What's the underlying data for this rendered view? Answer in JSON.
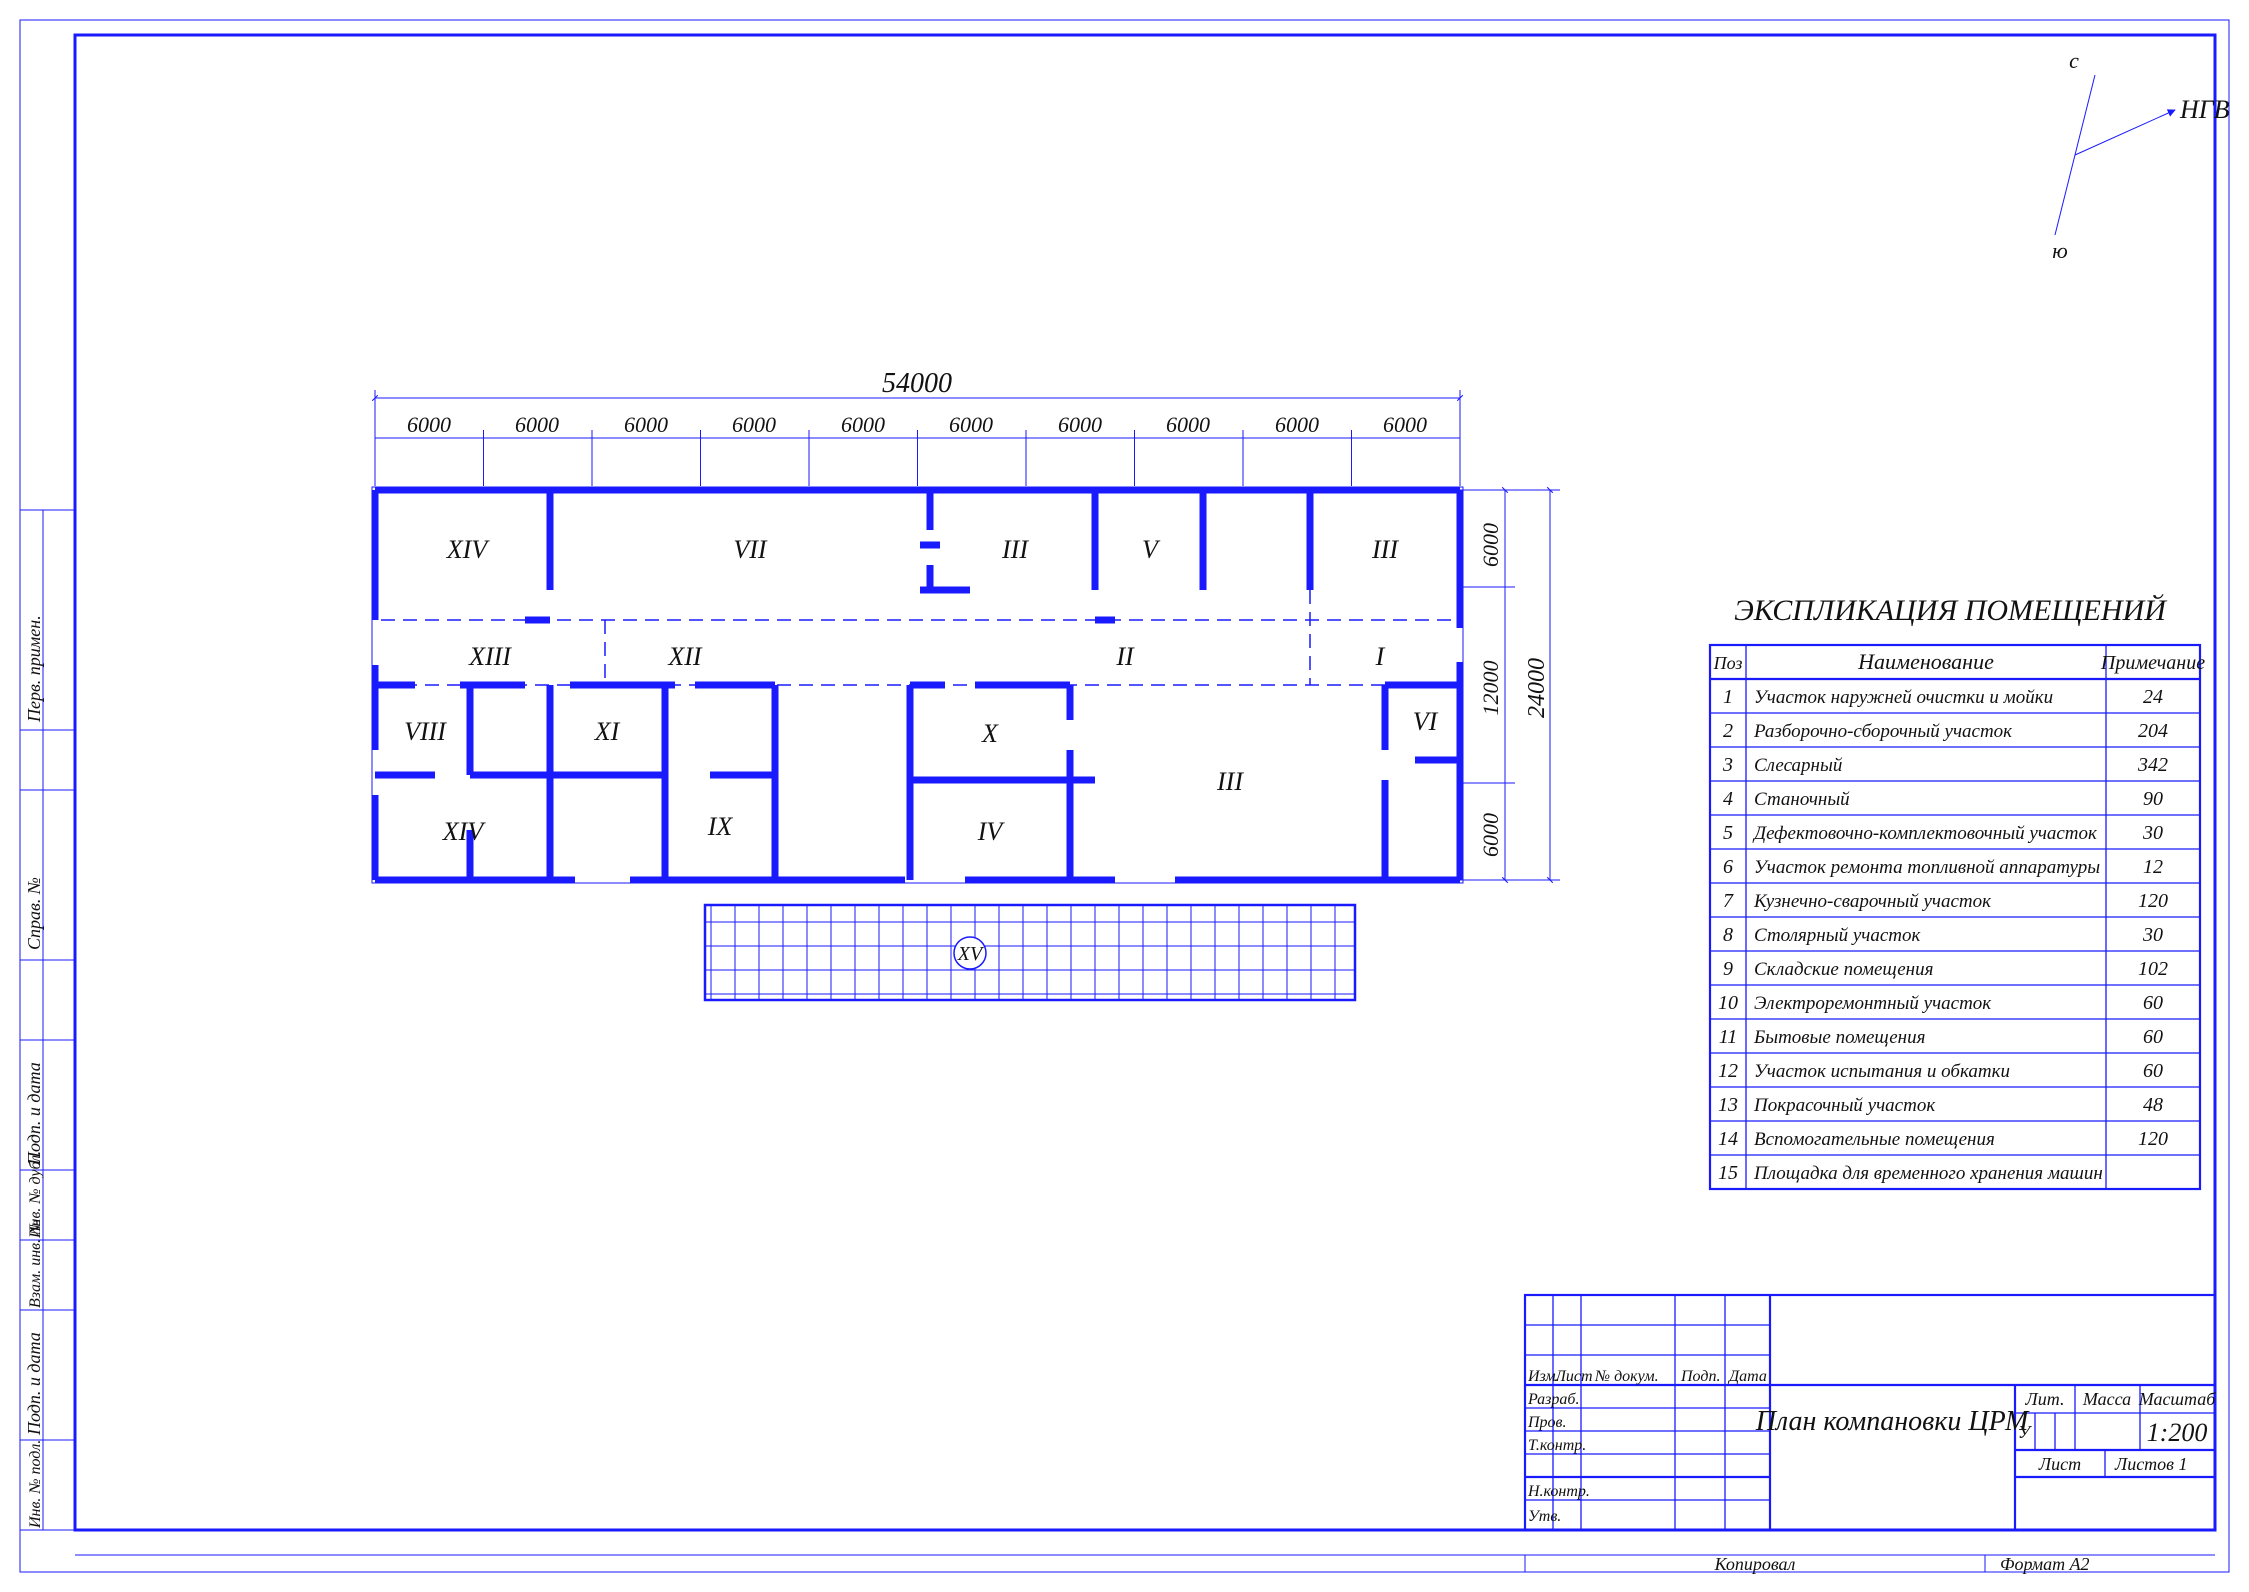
{
  "compass": {
    "n": "с",
    "s": "ю",
    "arrow": "НГВ"
  },
  "dims": {
    "total_w": "54000",
    "bays": [
      "6000",
      "6000",
      "6000",
      "6000",
      "6000",
      "6000",
      "6000",
      "6000",
      "6000",
      "6000"
    ],
    "right_total": "24000",
    "right_top": "6000",
    "right_mid": "12000",
    "right_bot": "6000"
  },
  "rooms": {
    "xiv_top": "XIV",
    "vii": "VII",
    "iii_top": "III",
    "v": "V",
    "iii_r": "III",
    "xiii": "XIII",
    "xii": "XII",
    "ii": "II",
    "i": "I",
    "viii": "VIII",
    "xi": "XI",
    "x": "X",
    "vi": "VI",
    "xiv_bot": "XIV",
    "ix": "IX",
    "iv": "IV",
    "iii_mid": "III",
    "xv": "XV"
  },
  "exp": {
    "title": "ЭКСПЛИКАЦИЯ ПОМЕЩЕНИЙ",
    "h1": "Поз",
    "h2": "Наименование",
    "h3": "Примечание",
    "rows": [
      {
        "n": "1",
        "name": "Участок наружней очистки и мойки",
        "note": "24"
      },
      {
        "n": "2",
        "name": "Разборочно-сборочный участок",
        "note": "204"
      },
      {
        "n": "3",
        "name": "Слесарный",
        "note": "342"
      },
      {
        "n": "4",
        "name": "Станочный",
        "note": "90"
      },
      {
        "n": "5",
        "name": "Дефектовочно-комплектовочный участок",
        "note": "30"
      },
      {
        "n": "6",
        "name": "Участок ремонта топливной аппаратуры",
        "note": "12"
      },
      {
        "n": "7",
        "name": "Кузнечно-сварочный участок",
        "note": "120"
      },
      {
        "n": "8",
        "name": "Столярный участок",
        "note": "30"
      },
      {
        "n": "9",
        "name": "Складские помещения",
        "note": "102"
      },
      {
        "n": "10",
        "name": "Электроремонтный участок",
        "note": "60"
      },
      {
        "n": "11",
        "name": "Бытовые помещения",
        "note": "60"
      },
      {
        "n": "12",
        "name": "Участок испытания и обкатки",
        "note": "60"
      },
      {
        "n": "13",
        "name": "Покрасочный участок",
        "note": "48"
      },
      {
        "n": "14",
        "name": "Вспомогательные помещения",
        "note": "120"
      },
      {
        "n": "15",
        "name": "Площадка для временного хранения машин",
        "note": ""
      }
    ]
  },
  "titleblock": {
    "izm": "Изм.",
    "list": "Лист",
    "ndokum": "№ докум.",
    "podp": "Подп.",
    "data": "Дата",
    "razrab": "Разраб.",
    "prov": "Пров.",
    "tkontr": "Т.контр.",
    "nkontr": "Н.контр.",
    "utv": "Утв.",
    "title": "План компановки ЦРМ",
    "lit": "Лит.",
    "massa": "Масса",
    "mashtab": "Масштаб",
    "scale": "1:200",
    "list2": "Лист",
    "listov": "Листов   1",
    "u": "У",
    "kopiroval": "Копировал",
    "format": "Формат   А2"
  },
  "sidebar": {
    "a": "Перв. примен.",
    "b": "Справ. №",
    "c": "Подп. и дата",
    "d": "Инв. № дубл.",
    "e": "Взам. инв. №",
    "f": "Подп. и дата",
    "g": "Инв. № подл."
  }
}
